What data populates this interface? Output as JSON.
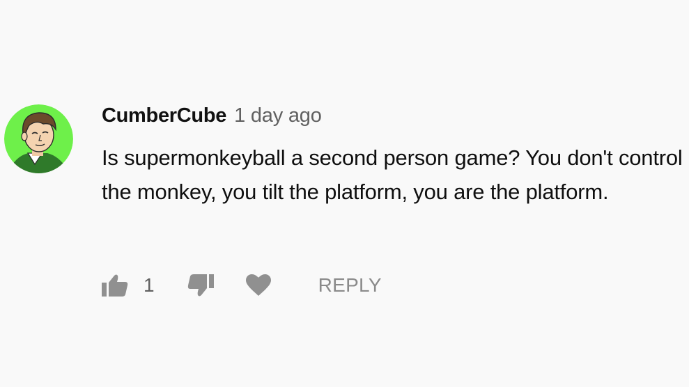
{
  "comment": {
    "author": "CumberCube",
    "timestamp": "1 day ago",
    "text": "Is supermonkeyball a second person game? You don't control the monkey, you tilt the platform, you are the platform.",
    "like_count": "1",
    "reply_label": "REPLY",
    "avatar_bg_color": "#6ef04a"
  },
  "icons": {
    "like": "thumbs-up-icon",
    "dislike": "thumbs-down-icon",
    "heart": "heart-icon"
  },
  "colors": {
    "background": "#f9f9f9",
    "author": "#111111",
    "secondary": "#606060",
    "icon": "#909090"
  }
}
